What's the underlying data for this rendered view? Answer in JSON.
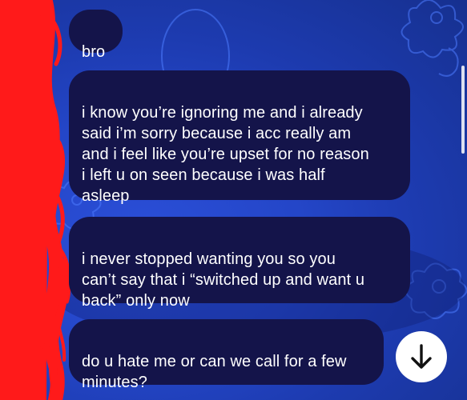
{
  "conversation": {
    "messages": [
      {
        "text": "bro"
      },
      {
        "text": "i know you’re ignoring me and i already\nsaid i’m sorry because i acc really am\nand i feel like you’re upset for no reason\ni left u on seen because i was half\nasleep"
      },
      {
        "text": "i never stopped wanting you so you\ncan’t say that i “switched up and want u\nback” only now"
      },
      {
        "text": "do u hate me or can we call for a few\nminutes?"
      }
    ]
  },
  "scroll_button": {
    "icon": "arrow-down-icon"
  },
  "colors": {
    "background": "#2446c8",
    "bubble": "#14144a",
    "bubble_text": "#ffffff",
    "redaction": "#ff1a1a"
  }
}
